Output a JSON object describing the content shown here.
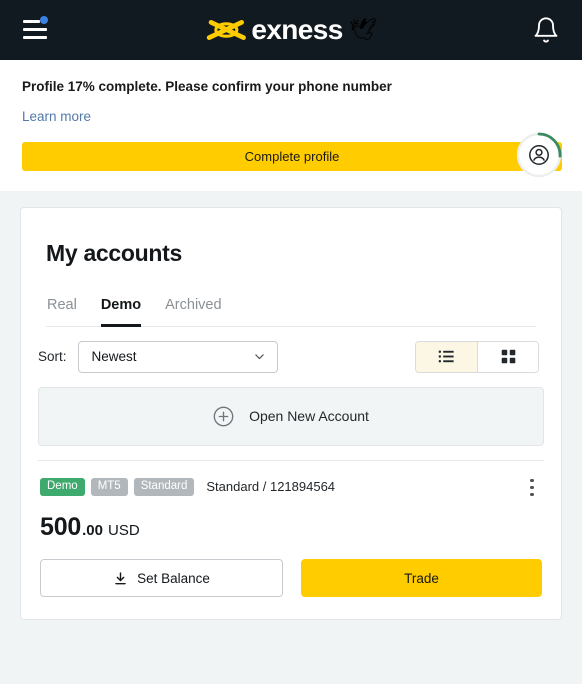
{
  "topbar": {
    "menu_icon": "hamburger-menu-icon",
    "menu_badge": "notification-dot",
    "logo_text": "exness",
    "logo_mark": "exness-x-mark",
    "logo_dove": "🕊",
    "bell_icon": "notification-bell-icon"
  },
  "banner": {
    "title": "Profile 17% complete. Please confirm your phone number",
    "learn_more": "Learn more",
    "cta_label": "Complete profile",
    "progress_percent": 17,
    "progress_color": "#3d8b63",
    "avatar_icon": "user-avatar-icon"
  },
  "accounts_card": {
    "title": "My accounts",
    "tabs": [
      {
        "label": "Real",
        "active": false
      },
      {
        "label": "Demo",
        "active": true
      },
      {
        "label": "Archived",
        "active": false
      }
    ],
    "sort": {
      "label": "Sort:",
      "value": "Newest",
      "options": [
        "Newest"
      ]
    },
    "view_modes": [
      {
        "name": "list-view",
        "active": true
      },
      {
        "name": "grid-view",
        "active": false
      }
    ],
    "open_new_account": "Open New Account",
    "accounts": [
      {
        "badges": [
          {
            "text": "Demo",
            "style": "green"
          },
          {
            "text": "MT5",
            "style": "gray"
          },
          {
            "text": "Standard",
            "style": "gray"
          }
        ],
        "meta": "Standard / 121894564",
        "balance_main": "500",
        "balance_frac": ".00",
        "balance_currency": "USD",
        "set_balance_label": "Set Balance",
        "trade_label": "Trade"
      }
    ]
  },
  "colors": {
    "brand_yellow": "#ffcc00",
    "topbar_bg": "#121a21",
    "demo_green": "#3eaa6d",
    "link_blue": "#5279ab"
  }
}
